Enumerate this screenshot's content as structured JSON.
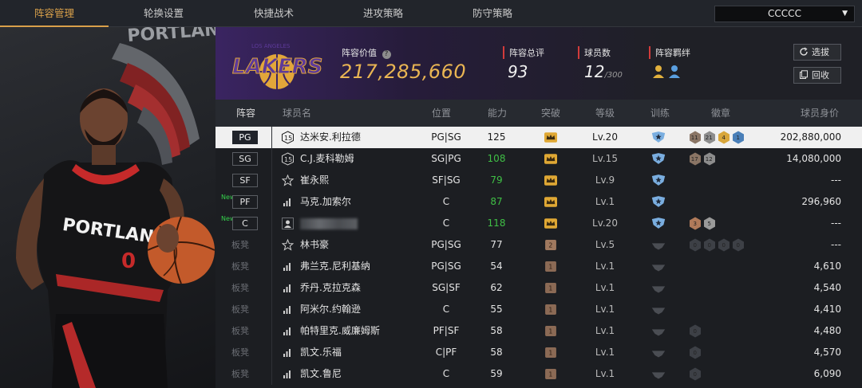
{
  "tabs": [
    {
      "label": "阵容管理",
      "active": true
    },
    {
      "label": "轮换设置",
      "active": false
    },
    {
      "label": "快捷战术",
      "active": false
    },
    {
      "label": "进攻策略",
      "active": false
    },
    {
      "label": "防守策略",
      "active": false
    }
  ],
  "dropdown": {
    "value": "CCCCC"
  },
  "hero": {
    "jersey_text": "PORTLAND",
    "number": "0",
    "wall_text": "PORTLAN"
  },
  "header": {
    "team_logo_text": "LAKERS",
    "team_logo_small": "LOS ANGELES",
    "lineup_value_label": "阵容价值",
    "lineup_value": "217,285,660",
    "rating_label": "阵容总评",
    "rating": "93",
    "players_label": "球员数",
    "players_count": "12",
    "players_max": "/300",
    "bond_label": "阵容羁绊",
    "select_btn": "选拔",
    "return_btn": "回收"
  },
  "columns": [
    "阵容",
    "球员名",
    "位置",
    "能力",
    "突破",
    "等级",
    "训练",
    "徽章",
    "球员身价"
  ],
  "rows": [
    {
      "slot": "PG",
      "new": false,
      "name_icon": "number-15-icon",
      "name": "达米安.利拉德",
      "position": "PG|SG",
      "ability": "125",
      "ability_green": false,
      "breakthrough": "crown-gold",
      "level": "Lv.20",
      "training": "star-shield",
      "badges": [
        "11",
        "21",
        "4",
        "1"
      ],
      "value": "202,880,000",
      "selected": true
    },
    {
      "slot": "SG",
      "new": false,
      "name_icon": "number-15-icon",
      "name": "C.J.麦科勒姆",
      "position": "SG|PG",
      "ability": "108",
      "ability_green": true,
      "breakthrough": "crown-gold",
      "level": "Lv.15",
      "training": "star-shield",
      "badges": [
        "17",
        "12"
      ],
      "value": "14,080,000"
    },
    {
      "slot": "SF",
      "new": false,
      "name_icon": "star-outline-icon",
      "name": "崔永熙",
      "position": "SF|SG",
      "ability": "79",
      "ability_green": true,
      "breakthrough": "crown-gold",
      "level": "Lv.9",
      "training": "star-shield",
      "badges": [],
      "value": "---"
    },
    {
      "slot": "PF",
      "new": true,
      "new_label": "New",
      "name_icon": "bars-icon",
      "name": "马克.加索尔",
      "position": "C",
      "ability": "87",
      "ability_green": true,
      "breakthrough": "crown-gold",
      "level": "Lv.1",
      "training": "star-shield",
      "badges": [],
      "value": "296,960"
    },
    {
      "slot": "C",
      "new": true,
      "new_label": "New",
      "name_icon": "person-icon",
      "name": "",
      "position": "C",
      "ability": "118",
      "ability_green": true,
      "breakthrough": "crown-gold",
      "level": "Lv.20",
      "training": "star-shield",
      "badges": [
        "3",
        "5"
      ],
      "value": "---"
    },
    {
      "slot": "板凳",
      "bench": true,
      "name_icon": "star-outline-icon",
      "name": "林书豪",
      "position": "PG|SG",
      "ability": "77",
      "breakthrough": "crown-2",
      "breakthrough_text": "2",
      "level": "Lv.5",
      "training": "gray",
      "badges": [
        "0",
        "0",
        "0",
        "0"
      ],
      "value": "---"
    },
    {
      "slot": "板凳",
      "bench": true,
      "name_icon": "bars-icon",
      "name": "弗兰克.尼利基纳",
      "position": "PG|SG",
      "ability": "54",
      "breakthrough": "crown-1",
      "breakthrough_text": "1",
      "level": "Lv.1",
      "training": "gray",
      "badges": [],
      "value": "4,610"
    },
    {
      "slot": "板凳",
      "bench": true,
      "name_icon": "bars-icon",
      "name": "乔丹.克拉克森",
      "position": "SG|SF",
      "ability": "62",
      "breakthrough": "crown-1",
      "breakthrough_text": "1",
      "level": "Lv.1",
      "training": "gray",
      "badges": [],
      "value": "4,540"
    },
    {
      "slot": "板凳",
      "bench": true,
      "name_icon": "bars-icon",
      "name": "阿米尔.约翰逊",
      "position": "C",
      "ability": "55",
      "breakthrough": "crown-1",
      "breakthrough_text": "1",
      "level": "Lv.1",
      "training": "gray",
      "badges": [],
      "value": "4,410"
    },
    {
      "slot": "板凳",
      "bench": true,
      "name_icon": "bars-icon",
      "name": "帕特里克.威廉姆斯",
      "position": "PF|SF",
      "ability": "58",
      "breakthrough": "crown-1",
      "breakthrough_text": "1",
      "level": "Lv.1",
      "training": "gray",
      "badges": [
        "0"
      ],
      "value": "4,480"
    },
    {
      "slot": "板凳",
      "bench": true,
      "name_icon": "bars-icon",
      "name": "凯文.乐福",
      "position": "C|PF",
      "ability": "58",
      "breakthrough": "crown-1",
      "breakthrough_text": "1",
      "level": "Lv.1",
      "training": "gray",
      "badges": [
        "0"
      ],
      "value": "4,570"
    },
    {
      "slot": "板凳",
      "bench": true,
      "name_icon": "bars-icon",
      "name": "凯文.鲁尼",
      "position": "C",
      "ability": "59",
      "breakthrough": "crown-1",
      "breakthrough_text": "1",
      "level": "Lv.1",
      "training": "gray",
      "badges": [
        "0"
      ],
      "value": "6,090"
    }
  ]
}
